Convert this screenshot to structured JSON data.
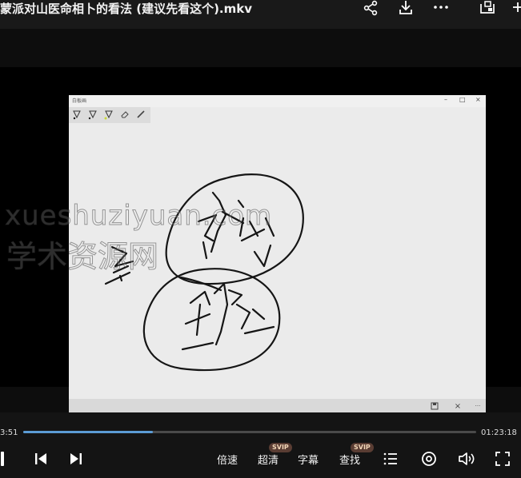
{
  "window": {
    "title": "蒙派对山医命相卜的看法 (建议先看这个).mkv"
  },
  "top_icons": [
    "share-icon",
    "download-icon",
    "more-icon",
    "pip-icon",
    "add-icon"
  ],
  "video": {
    "app_title": "白板画",
    "watermark_latin": "xueshuziyuan.com",
    "watermark_cjk": "学术资源网",
    "canvas_controls": {
      "minimize": "–",
      "maximize": "□",
      "close": "×"
    },
    "bottom_controls": {
      "save": "🖫",
      "close": "×",
      "more": "···"
    }
  },
  "playback": {
    "current_time": "3:51",
    "total_time": "01:23:18",
    "progress": 0.287
  },
  "controls": {
    "speed_label": "倍速",
    "quality_label": "超清",
    "quality_badge": "SVIP",
    "subtitle_label": "字幕",
    "search_label": "查找",
    "search_badge": "SVIP"
  },
  "colors": {
    "accent": "#5b9bd5",
    "badge_bg": "#5a3d33",
    "badge_text": "#f3d7b8"
  }
}
